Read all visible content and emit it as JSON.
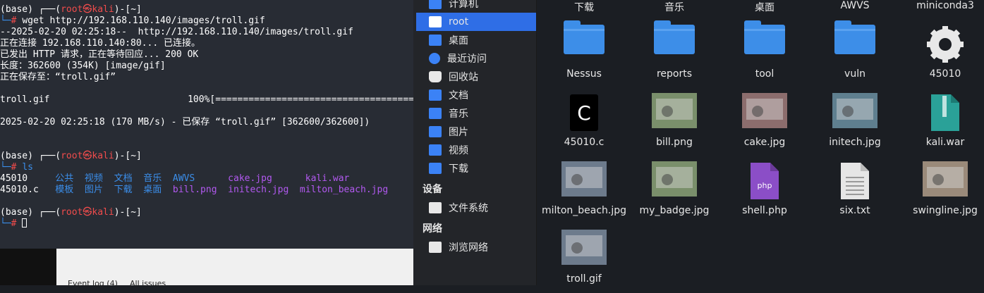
{
  "terminal": {
    "lines": [
      {
        "parts": [
          {
            "t": "(base) ┌──(",
            "c": "white"
          },
          {
            "t": "root㉿kali",
            "c": "red"
          },
          {
            "t": ")-[",
            "c": "white"
          },
          {
            "t": "~",
            "c": "white"
          },
          {
            "t": "]",
            "c": "white"
          }
        ]
      },
      {
        "parts": [
          {
            "t": "└─",
            "c": "blue"
          },
          {
            "t": "# ",
            "c": "red"
          },
          {
            "t": "wget http://192.168.110.140/images/troll.gif",
            "c": "white"
          }
        ]
      },
      {
        "parts": [
          {
            "t": "--2025-02-20 02:25:18--  http://192.168.110.140/images/troll.gif",
            "c": "white"
          }
        ]
      },
      {
        "parts": [
          {
            "t": "正在连接 192.168.110.140:80... 已连接。",
            "c": "white"
          }
        ]
      },
      {
        "parts": [
          {
            "t": "已发出 HTTP 请求，正在等待回应... 200 OK",
            "c": "white"
          }
        ]
      },
      {
        "parts": [
          {
            "t": "长度：362600 (354K) [image/gif]",
            "c": "white"
          }
        ]
      },
      {
        "parts": [
          {
            "t": "正在保存至：“troll.gif”",
            "c": "white"
          }
        ]
      },
      {
        "parts": [
          {
            "t": "",
            "c": "white"
          }
        ]
      },
      {
        "parts": [
          {
            "t": "troll.gif                         100%[=========================================",
            "c": "white"
          }
        ]
      },
      {
        "parts": [
          {
            "t": "",
            "c": "white"
          }
        ]
      },
      {
        "parts": [
          {
            "t": "2025-02-20 02:25:18 (170 MB/s) - 已保存 “troll.gif” [362600/362600])",
            "c": "white"
          }
        ]
      },
      {
        "parts": [
          {
            "t": "",
            "c": "white"
          }
        ]
      },
      {
        "parts": [
          {
            "t": "",
            "c": "white"
          }
        ]
      },
      {
        "parts": [
          {
            "t": "(base) ┌──(",
            "c": "white"
          },
          {
            "t": "root㉿kali",
            "c": "red"
          },
          {
            "t": ")-[",
            "c": "white"
          },
          {
            "t": "~",
            "c": "white"
          },
          {
            "t": "]",
            "c": "white"
          }
        ]
      },
      {
        "parts": [
          {
            "t": "└─",
            "c": "blue"
          },
          {
            "t": "# ",
            "c": "red"
          },
          {
            "t": "ls",
            "c": "blue"
          }
        ]
      },
      {
        "parts": [
          {
            "t": "45010     ",
            "c": "white"
          },
          {
            "t": "公共  视频  文档  音乐  AWVS      ",
            "c": "blue"
          },
          {
            "t": "cake.jpg      kali.war",
            "c": "purple"
          }
        ]
      },
      {
        "parts": [
          {
            "t": "45010.c   ",
            "c": "white"
          },
          {
            "t": "模板  图片  下载  桌面  ",
            "c": "blue"
          },
          {
            "t": "bill.png  initech.jpg  milton_beach.jpg",
            "c": "purple"
          }
        ]
      },
      {
        "parts": [
          {
            "t": "",
            "c": "white"
          }
        ]
      },
      {
        "parts": [
          {
            "t": "(base) ┌──(",
            "c": "white"
          },
          {
            "t": "root㉿kali",
            "c": "red"
          },
          {
            "t": ")-[",
            "c": "white"
          },
          {
            "t": "~",
            "c": "white"
          },
          {
            "t": "]",
            "c": "white"
          }
        ]
      },
      {
        "parts": [
          {
            "t": "└─",
            "c": "blue"
          },
          {
            "t": "# ",
            "c": "red"
          }
        ]
      }
    ]
  },
  "bottom_tabs": {
    "event_log": "Event log (4)",
    "all_issues": "All issues"
  },
  "sidebar": {
    "items": [
      {
        "label": "计算机",
        "icon": "computer-icon"
      },
      {
        "label": "root",
        "icon": "home-folder-icon"
      },
      {
        "label": "桌面",
        "icon": "desktop-icon"
      },
      {
        "label": "最近访问",
        "icon": "recent-icon"
      },
      {
        "label": "回收站",
        "icon": "trash-icon"
      },
      {
        "label": "文档",
        "icon": "documents-icon"
      },
      {
        "label": "音乐",
        "icon": "music-icon"
      },
      {
        "label": "图片",
        "icon": "pictures-icon"
      },
      {
        "label": "视频",
        "icon": "videos-icon"
      },
      {
        "label": "下载",
        "icon": "downloads-icon"
      }
    ],
    "devices_heading": "设备",
    "filesystem": "文件系统",
    "network_heading": "网络",
    "browse_network": "浏览网络"
  },
  "files": {
    "top_labels": [
      "下载",
      "音乐",
      "桌面",
      "AWVS",
      "miniconda3"
    ],
    "row1": [
      {
        "name": "Nessus",
        "kind": "folder"
      },
      {
        "name": "reports",
        "kind": "folder"
      },
      {
        "name": "tool",
        "kind": "folder"
      },
      {
        "name": "vuln",
        "kind": "folder"
      },
      {
        "name": "45010",
        "kind": "gear"
      }
    ],
    "row2": [
      {
        "name": "45010.c",
        "kind": "c"
      },
      {
        "name": "bill.png",
        "kind": "img"
      },
      {
        "name": "cake.jpg",
        "kind": "img"
      },
      {
        "name": "initech.jpg",
        "kind": "img"
      },
      {
        "name": "kali.war",
        "kind": "zip"
      }
    ],
    "row3": [
      {
        "name": "milton_beach.jpg",
        "kind": "img"
      },
      {
        "name": "my_badge.jpg",
        "kind": "img"
      },
      {
        "name": "shell.php",
        "kind": "php"
      },
      {
        "name": "six.txt",
        "kind": "txt"
      },
      {
        "name": "swingline.jpg",
        "kind": "img"
      }
    ],
    "row4": [
      {
        "name": "troll.gif",
        "kind": "img"
      }
    ]
  },
  "colors": {
    "accent": "#2f6ee6",
    "folder": "#3d8ee8"
  }
}
